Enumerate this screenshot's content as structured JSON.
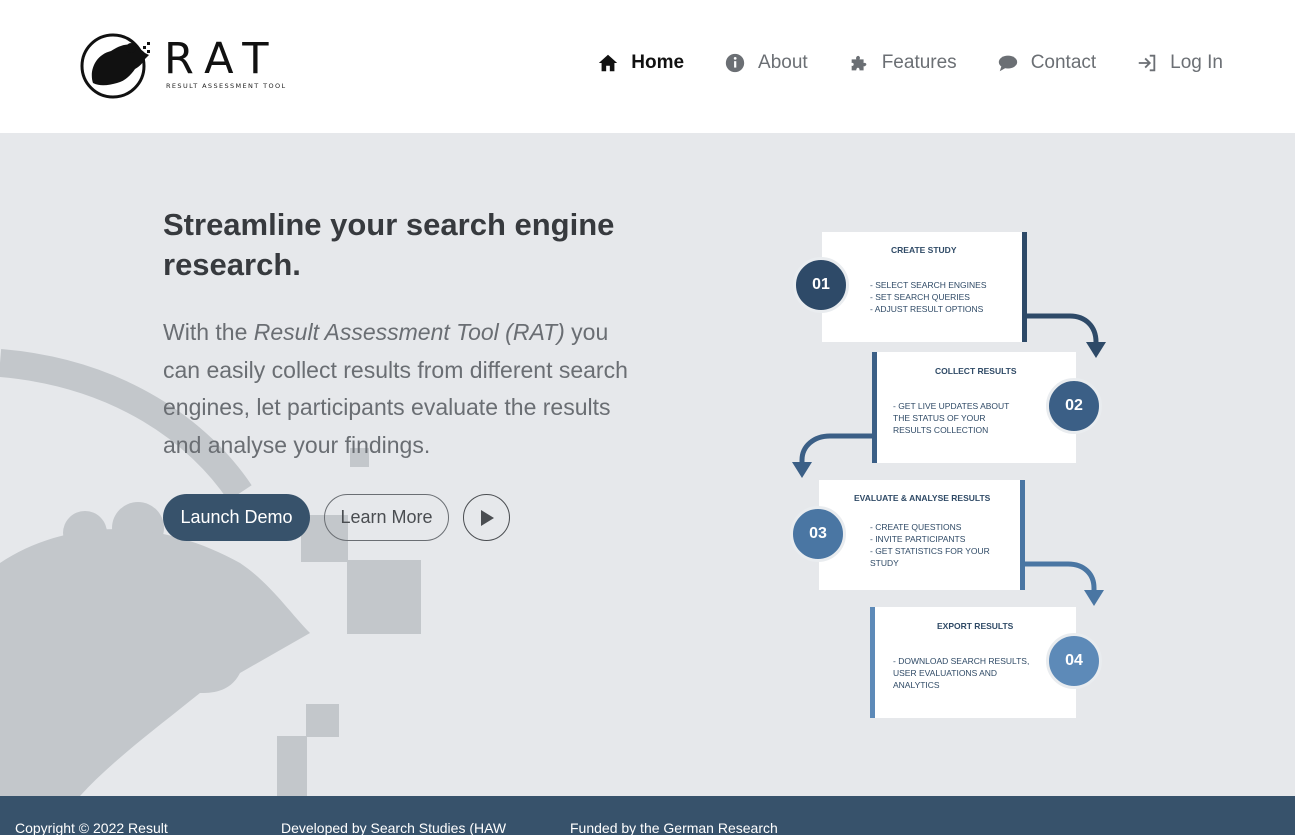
{
  "logo": {
    "word": "RAT",
    "subtitle": "RESULT ASSESSMENT TOOL"
  },
  "nav": [
    {
      "label": "Home",
      "icon": "home-icon",
      "active": true
    },
    {
      "label": "About",
      "icon": "info-icon",
      "active": false
    },
    {
      "label": "Features",
      "icon": "puzzle-icon",
      "active": false
    },
    {
      "label": "Contact",
      "icon": "chat-icon",
      "active": false
    },
    {
      "label": "Log In",
      "icon": "login-icon",
      "active": false
    }
  ],
  "hero": {
    "title": "Streamline your search engine research.",
    "text_before": "With the ",
    "text_em": "Result Assessment Tool (RAT)",
    "text_after": " you can easily collect results from different search engines, let participants evaluate the results and analyse your findings.",
    "launch_label": "Launch Demo",
    "learn_label": "Learn More",
    "play_icon": "play-icon"
  },
  "steps": [
    {
      "num": "01",
      "title": "CREATE STUDY",
      "lines": [
        "- SELECT SEARCH ENGINES",
        "- SET SEARCH QUERIES",
        "- ADJUST RESULT OPTIONS"
      ]
    },
    {
      "num": "02",
      "title": "COLLECT RESULTS",
      "lines": [
        "- GET LIVE UPDATES ABOUT",
        "THE STATUS OF YOUR",
        "RESULTS COLLECTION"
      ]
    },
    {
      "num": "03",
      "title": "EVALUATE & ANALYSE RESULTS",
      "lines": [
        "- CREATE QUESTIONS",
        "- INVITE PARTICIPANTS",
        "- GET STATISTICS FOR YOUR",
        "STUDY"
      ]
    },
    {
      "num": "04",
      "title": "EXPORT RESULTS",
      "lines": [
        "- DOWNLOAD SEARCH RESULTS,",
        "USER EVALUATIONS AND",
        "ANALYTICS"
      ]
    }
  ],
  "colors": {
    "primary": "#37526b",
    "step1": "#2e4a68",
    "step2": "#3b5f86",
    "step3": "#4a76a3",
    "step4": "#5d8ab8",
    "hero_bg": "#e6e8eb"
  },
  "footer": {
    "copyright": "Copyright © 2022 Result",
    "developed": "Developed by Search Studies (HAW",
    "funded": "Funded by the German Research"
  }
}
